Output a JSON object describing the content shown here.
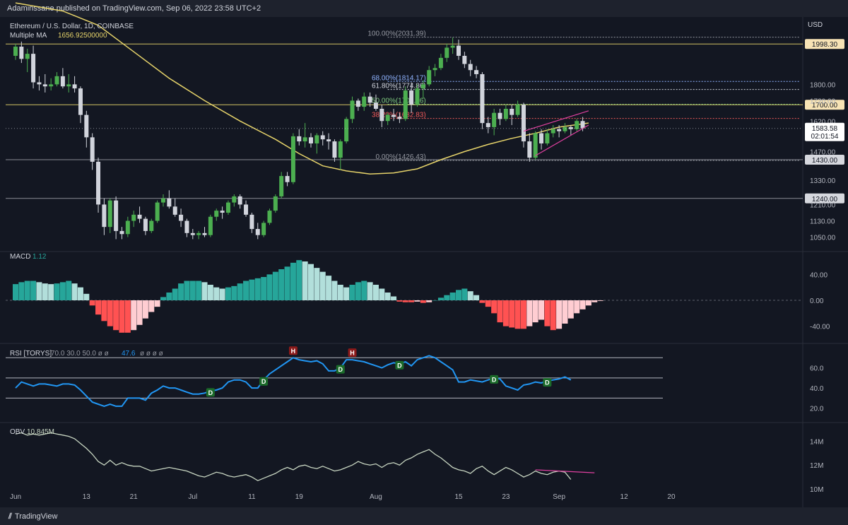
{
  "header": {
    "published": "Adaminssane published on TradingView.com, Sep 06, 2022 23:58 UTC+2"
  },
  "footer": {
    "brand": "TradingView"
  },
  "colors": {
    "bg": "#131722",
    "up": "#4caf50",
    "down": "#d1d4dc",
    "ma": "#e6d36a",
    "fib_hi": "#9598a1",
    "fib_618": "#8fb3ff",
    "fib_382": "#f05a5a",
    "fib_50": "#7ec97e",
    "macd_pos_strong": "#26a69a",
    "macd_pos_weak": "#b2dfdb",
    "macd_neg_strong": "#ff5252",
    "macd_neg_weak": "#ffcdd2",
    "rsi": "#2196f3",
    "obv": "#c8d6c2",
    "trend": "#e040a0"
  },
  "chart_data": {
    "type": "candlestick",
    "title": "Ethereum / U.S. Dollar, 1D, COINBASE",
    "currency": "USD",
    "ma_label": "Multiple MA",
    "ma_value": "1656.92500000",
    "price_axis": {
      "range": [
        1000,
        2110
      ],
      "ticks": [
        "1800.00",
        "1720.00",
        "1620.00",
        "1550.00",
        "1470.00",
        "1330.00",
        "1210.00",
        "1130.00",
        "1050.00"
      ]
    },
    "date_axis": {
      "labels": [
        "Jun",
        "13",
        "21",
        "Jul",
        "11",
        "19",
        "Aug",
        "15",
        "23",
        "Sep",
        "12",
        "20"
      ],
      "dates": [
        "2022-06-01",
        "2022-06-13",
        "2022-06-21",
        "2022-07-01",
        "2022-07-11",
        "2022-07-19",
        "2022-08-01",
        "2022-08-15",
        "2022-08-23",
        "2022-09-01",
        "2022-09-12",
        "2022-09-20"
      ]
    },
    "horizontal_levels": [
      {
        "value": 1998.3,
        "label": "1998.30",
        "color": "#e6d36a"
      },
      {
        "value": 1700.0,
        "label": "1700.00",
        "color": "#e6d36a"
      },
      {
        "value": 1430.0,
        "label": "1430.00",
        "color": "#9598a1"
      },
      {
        "value": 1240.0,
        "label": "1240.00",
        "color": "#9598a1"
      }
    ],
    "last_price": {
      "value": 1583.58,
      "label": "1583.58",
      "countdown": "02:01:54"
    },
    "fibonacci": [
      {
        "label": "100.00%(2031.39)",
        "value": 2031.39,
        "color": "#9598a1"
      },
      {
        "label": "68.00%(1814.17)",
        "value": 1814.17,
        "color": "#8fb3ff"
      },
      {
        "label": "61.80%(1774.86)",
        "value": 1774.86,
        "color": "#d1d4dc"
      },
      {
        "label": "50.00%(1702.36)",
        "value": 1702.36,
        "color": "#7ec97e"
      },
      {
        "label": "38.20%(1632.83)",
        "value": 1632.83,
        "color": "#f05a5a"
      },
      {
        "label": "0.00%(1426.43)",
        "value": 1426.43,
        "color": "#9598a1"
      }
    ],
    "candles_start": "2022-06-01",
    "ohlc": [
      [
        1940,
        2000,
        1920,
        1985
      ],
      [
        1985,
        2010,
        1905,
        1925
      ],
      [
        1925,
        1975,
        1860,
        1950
      ],
      [
        1950,
        1990,
        1780,
        1810
      ],
      [
        1810,
        1840,
        1770,
        1800
      ],
      [
        1800,
        1850,
        1760,
        1790
      ],
      [
        1790,
        1830,
        1770,
        1800
      ],
      [
        1800,
        1860,
        1790,
        1840
      ],
      [
        1840,
        1880,
        1780,
        1790
      ],
      [
        1790,
        1850,
        1760,
        1800
      ],
      [
        1800,
        1840,
        1760,
        1780
      ],
      [
        1780,
        1790,
        1610,
        1650
      ],
      [
        1650,
        1670,
        1490,
        1540
      ],
      [
        1540,
        1560,
        1380,
        1420
      ],
      [
        1420,
        1440,
        1170,
        1210
      ],
      [
        1210,
        1240,
        1060,
        1100
      ],
      [
        1100,
        1240,
        1070,
        1230
      ],
      [
        1230,
        1250,
        1040,
        1080
      ],
      [
        1080,
        1100,
        1040,
        1065
      ],
      [
        1065,
        1150,
        1050,
        1130
      ],
      [
        1130,
        1180,
        1100,
        1160
      ],
      [
        1160,
        1200,
        1120,
        1140
      ],
      [
        1140,
        1150,
        1060,
        1080
      ],
      [
        1080,
        1140,
        1070,
        1130
      ],
      [
        1130,
        1230,
        1120,
        1220
      ],
      [
        1220,
        1260,
        1200,
        1240
      ],
      [
        1240,
        1280,
        1190,
        1200
      ],
      [
        1200,
        1240,
        1150,
        1160
      ],
      [
        1160,
        1190,
        1100,
        1130
      ],
      [
        1130,
        1140,
        1050,
        1070
      ],
      [
        1070,
        1090,
        1040,
        1060
      ],
      [
        1060,
        1080,
        1040,
        1070
      ],
      [
        1070,
        1100,
        1050,
        1060
      ],
      [
        1060,
        1160,
        1050,
        1150
      ],
      [
        1150,
        1190,
        1130,
        1180
      ],
      [
        1180,
        1200,
        1140,
        1170
      ],
      [
        1170,
        1230,
        1160,
        1220
      ],
      [
        1220,
        1260,
        1200,
        1250
      ],
      [
        1250,
        1260,
        1190,
        1210
      ],
      [
        1210,
        1230,
        1150,
        1160
      ],
      [
        1160,
        1170,
        1070,
        1090
      ],
      [
        1090,
        1120,
        1040,
        1060
      ],
      [
        1060,
        1130,
        1050,
        1120
      ],
      [
        1120,
        1190,
        1110,
        1180
      ],
      [
        1180,
        1260,
        1170,
        1250
      ],
      [
        1250,
        1370,
        1240,
        1350
      ],
      [
        1350,
        1370,
        1300,
        1320
      ],
      [
        1320,
        1560,
        1310,
        1545
      ],
      [
        1545,
        1580,
        1500,
        1520
      ],
      [
        1520,
        1610,
        1490,
        1540
      ],
      [
        1540,
        1560,
        1490,
        1510
      ],
      [
        1510,
        1560,
        1460,
        1550
      ],
      [
        1550,
        1570,
        1500,
        1530
      ],
      [
        1530,
        1560,
        1480,
        1520
      ],
      [
        1520,
        1530,
        1420,
        1440
      ],
      [
        1440,
        1530,
        1380,
        1520
      ],
      [
        1520,
        1640,
        1510,
        1630
      ],
      [
        1630,
        1740,
        1610,
        1720
      ],
      [
        1720,
        1730,
        1670,
        1690
      ],
      [
        1690,
        1760,
        1670,
        1740
      ],
      [
        1740,
        1760,
        1690,
        1710
      ],
      [
        1710,
        1750,
        1670,
        1680
      ],
      [
        1680,
        1700,
        1590,
        1620
      ],
      [
        1620,
        1660,
        1600,
        1650
      ],
      [
        1650,
        1680,
        1620,
        1640
      ],
      [
        1640,
        1660,
        1610,
        1630
      ],
      [
        1630,
        1790,
        1620,
        1770
      ],
      [
        1770,
        1810,
        1660,
        1700
      ],
      [
        1700,
        1800,
        1690,
        1780
      ],
      [
        1780,
        1820,
        1730,
        1800
      ],
      [
        1800,
        1890,
        1790,
        1870
      ],
      [
        1870,
        1900,
        1840,
        1880
      ],
      [
        1880,
        1950,
        1870,
        1930
      ],
      [
        1930,
        2000,
        1910,
        1980
      ],
      [
        1980,
        2030,
        1950,
        1990
      ],
      [
        1990,
        2020,
        1920,
        1940
      ],
      [
        1940,
        1960,
        1880,
        1900
      ],
      [
        1900,
        1920,
        1840,
        1870
      ],
      [
        1870,
        1890,
        1830,
        1850
      ],
      [
        1850,
        1860,
        1580,
        1610
      ],
      [
        1610,
        1640,
        1560,
        1590
      ],
      [
        1590,
        1680,
        1550,
        1660
      ],
      [
        1660,
        1680,
        1600,
        1630
      ],
      [
        1630,
        1700,
        1620,
        1680
      ],
      [
        1680,
        1700,
        1600,
        1650
      ],
      [
        1650,
        1720,
        1640,
        1700
      ],
      [
        1700,
        1710,
        1490,
        1520
      ],
      [
        1520,
        1560,
        1420,
        1440
      ],
      [
        1440,
        1570,
        1430,
        1560
      ],
      [
        1560,
        1580,
        1480,
        1510
      ],
      [
        1510,
        1580,
        1500,
        1560
      ],
      [
        1560,
        1600,
        1540,
        1580
      ],
      [
        1580,
        1600,
        1540,
        1570
      ],
      [
        1570,
        1610,
        1560,
        1590
      ],
      [
        1590,
        1600,
        1550,
        1580
      ],
      [
        1580,
        1630,
        1570,
        1620
      ],
      [
        1620,
        1640,
        1570,
        1584
      ]
    ],
    "ma50": [
      [
        0,
        2200
      ],
      [
        8,
        2160
      ],
      [
        14,
        2090
      ],
      [
        20,
        1960
      ],
      [
        26,
        1830
      ],
      [
        32,
        1720
      ],
      [
        38,
        1620
      ],
      [
        44,
        1530
      ],
      [
        48,
        1460
      ],
      [
        52,
        1400
      ],
      [
        56,
        1375
      ],
      [
        60,
        1360
      ],
      [
        64,
        1365
      ],
      [
        68,
        1385
      ],
      [
        72,
        1430
      ],
      [
        76,
        1470
      ],
      [
        80,
        1505
      ],
      [
        84,
        1535
      ],
      [
        88,
        1560
      ],
      [
        92,
        1590
      ],
      [
        97,
        1610
      ]
    ],
    "trendlines": [
      {
        "from": [
          88,
          1450
        ],
        "to": [
          97,
          1600
        ]
      },
      {
        "from": [
          86,
          1570
        ],
        "to": [
          97,
          1670
        ]
      }
    ],
    "macd": {
      "label": "MACD",
      "value": "1.12",
      "axis": {
        "range": [
          -60,
          60
        ],
        "ticks": [
          "40.00",
          "0.00",
          "-40.00"
        ]
      },
      "hist": [
        25,
        28,
        30,
        30,
        28,
        26,
        25,
        26,
        28,
        30,
        26,
        20,
        10,
        -8,
        -22,
        -32,
        -40,
        -46,
        -50,
        -50,
        -46,
        -38,
        -28,
        -18,
        -10,
        5,
        12,
        18,
        26,
        30,
        30,
        30,
        28,
        24,
        20,
        18,
        20,
        22,
        26,
        30,
        32,
        34,
        36,
        40,
        44,
        48,
        52,
        58,
        62,
        60,
        56,
        50,
        44,
        38,
        30,
        24,
        20,
        24,
        28,
        30,
        28,
        24,
        18,
        12,
        6,
        -2,
        -3,
        -3,
        -2,
        -4,
        -3,
        0,
        4,
        8,
        12,
        16,
        18,
        14,
        8,
        -4,
        -10,
        -20,
        -34,
        -40,
        -42,
        -44,
        -44,
        -40,
        -34,
        -30,
        -40,
        -46,
        -44,
        -36,
        -28,
        -20,
        -14,
        -8,
        -3,
        -1
      ]
    },
    "rsi": {
      "label": "RSI [TORYS]",
      "params": "70.0 30.0 50.0 ø ø",
      "value": "47.6",
      "suffix": "ø ø ø ø",
      "axis": {
        "range": [
          10,
          80
        ],
        "ticks": [
          "60.0",
          "40.0",
          "20.0"
        ]
      },
      "levels": [
        70,
        50,
        30
      ],
      "values": [
        40,
        46,
        44,
        42,
        44,
        44,
        43,
        42,
        44,
        44,
        43,
        38,
        32,
        26,
        24,
        22,
        24,
        22,
        22,
        30,
        30,
        30,
        28,
        35,
        38,
        42,
        40,
        40,
        38,
        36,
        34,
        34,
        35,
        37,
        38,
        40,
        46,
        48,
        48,
        46,
        40,
        40,
        48,
        54,
        58,
        62,
        66,
        70,
        68,
        67,
        66,
        67,
        64,
        57,
        57,
        60,
        68,
        68,
        67,
        66,
        64,
        62,
        60,
        63,
        65,
        64,
        66,
        62,
        68,
        70,
        72,
        70,
        66,
        62,
        58,
        46,
        46,
        48,
        47,
        46,
        48,
        50,
        49,
        42,
        40,
        38,
        43,
        44,
        46,
        45,
        47,
        48,
        49,
        51,
        48
      ]
    },
    "rsi_markers": [
      {
        "i": 47,
        "label": "H",
        "kind": "top"
      },
      {
        "i": 57,
        "label": "H",
        "kind": "top"
      },
      {
        "i": 33,
        "label": "D",
        "kind": "bottom"
      },
      {
        "i": 42,
        "label": "D",
        "kind": "bottom"
      },
      {
        "i": 55,
        "label": "D",
        "kind": "bottom"
      },
      {
        "i": 65,
        "label": "D",
        "kind": "bottom"
      },
      {
        "i": 81,
        "label": "D",
        "kind": "bottom"
      },
      {
        "i": 90,
        "label": "D",
        "kind": "bottom"
      }
    ],
    "obv": {
      "label": "OBV",
      "value": "10.845M",
      "axis": {
        "range": [
          10.0,
          15.2
        ],
        "ticks": [
          "14M",
          "12M",
          "10M"
        ]
      },
      "values": [
        14.6,
        14.7,
        14.5,
        14.6,
        14.5,
        14.6,
        14.7,
        14.6,
        14.5,
        14.4,
        14.2,
        13.8,
        13.4,
        12.9,
        12.3,
        12.0,
        12.4,
        12.0,
        12.2,
        12.0,
        11.9,
        11.9,
        11.7,
        11.5,
        11.6,
        11.7,
        11.8,
        11.7,
        11.6,
        11.5,
        11.3,
        11.1,
        11.0,
        11.2,
        11.4,
        11.3,
        11.1,
        11.0,
        11.1,
        11.2,
        11.0,
        10.7,
        10.9,
        11.1,
        11.3,
        11.6,
        11.8,
        11.6,
        11.9,
        12.0,
        11.8,
        11.7,
        11.9,
        11.7,
        11.5,
        11.6,
        11.8,
        12.0,
        12.3,
        12.1,
        12.0,
        12.1,
        11.8,
        12.1,
        12.2,
        12.0,
        12.4,
        12.6,
        12.9,
        13.1,
        13.3,
        12.9,
        12.6,
        12.2,
        11.8,
        11.6,
        11.5,
        11.3,
        11.7,
        11.9,
        11.5,
        11.2,
        11.5,
        11.8,
        11.6,
        11.3,
        11.0,
        11.2,
        11.5,
        11.3,
        11.2,
        11.4,
        11.5,
        11.4,
        10.8
      ]
    }
  }
}
